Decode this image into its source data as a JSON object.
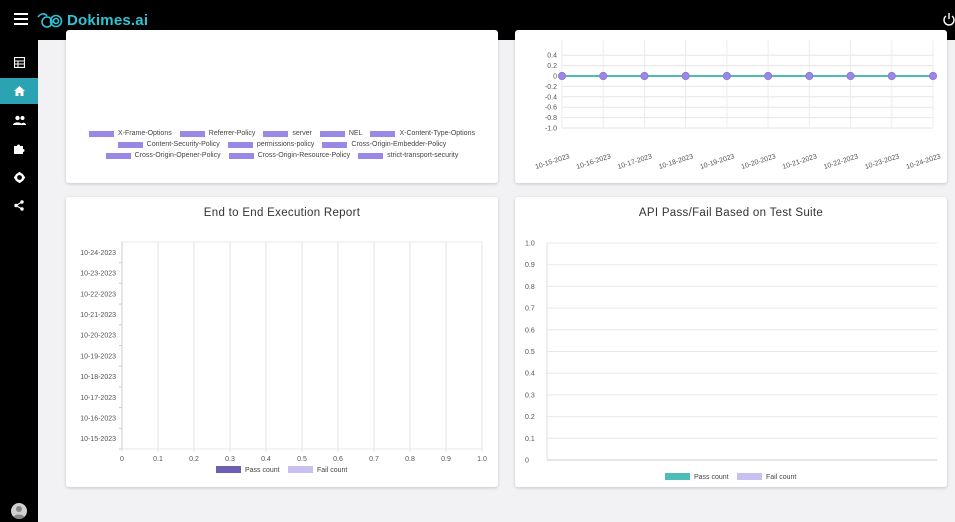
{
  "app": {
    "brand": "Dokimes.ai"
  },
  "sidebar": {
    "items": [
      {
        "icon": "table-icon"
      },
      {
        "icon": "home-icon",
        "active": true
      },
      {
        "icon": "users-icon"
      },
      {
        "icon": "puzzle-icon"
      },
      {
        "icon": "gear-icon"
      },
      {
        "icon": "share-icon"
      }
    ]
  },
  "colors": {
    "accent": "#2ba3b3",
    "brand": "#2ec4d6",
    "legend_purple": "#9b87e6",
    "line_teal": "#4bbcb6",
    "pass_dark": "#6f5fb3",
    "fail_light": "#c9bff0"
  },
  "security_headers_card": {
    "legend": [
      "X-Frame-Options",
      "Referrer-Policy",
      "server",
      "NEL",
      "X-Content-Type-Options",
      "Content-Security-Policy",
      "permissions-policy",
      "Cross-Origin-Embedder-Policy",
      "Cross-Origin-Opener-Policy",
      "Cross-Origin-Resource-Policy",
      "strict-transport-security"
    ]
  },
  "e2e_card": {
    "title": "End to End Execution Report",
    "legend": [
      "Pass count",
      "Fail count"
    ]
  },
  "api_card": {
    "title": "API Pass/Fail Based on Test Suite",
    "legend": [
      "Pass count",
      "Fail count"
    ]
  },
  "chart_data": [
    {
      "type": "line",
      "x": [
        "10-15-2023",
        "10-16-2023",
        "10-17-2023",
        "10-18-2023",
        "10-19-2023",
        "10-20-2023",
        "10-21-2023",
        "10-22-2023",
        "10-23-2023",
        "10-24-2023"
      ],
      "series": [
        {
          "values": [
            0,
            0,
            0,
            0,
            0,
            0,
            0,
            0,
            0,
            0
          ]
        }
      ],
      "yticks_visible": [
        "0.4",
        "0.2",
        "0",
        "-0.2",
        "-0.4",
        "-0.6",
        "-0.8",
        "-1.0"
      ],
      "ylim": [
        -1.0,
        0.4
      ],
      "grid": true
    },
    {
      "type": "bar",
      "orientation": "horizontal",
      "title": "End to End Execution Report",
      "categories": [
        "10-24-2023",
        "10-23-2023",
        "10-22-2023",
        "10-21-2023",
        "10-20-2023",
        "10-19-2023",
        "10-18-2023",
        "10-17-2023",
        "10-16-2023",
        "10-15-2023"
      ],
      "series": [
        {
          "name": "Pass count",
          "values": [
            0,
            0,
            0,
            0,
            0,
            0,
            0,
            0,
            0,
            0
          ]
        },
        {
          "name": "Fail count",
          "values": [
            0,
            0,
            0,
            0,
            0,
            0,
            0,
            0,
            0,
            0
          ]
        }
      ],
      "xticks": [
        "0",
        "0.1",
        "0.2",
        "0.3",
        "0.4",
        "0.5",
        "0.6",
        "0.7",
        "0.8",
        "0.9",
        "1.0"
      ],
      "xlim": [
        0,
        1.0
      ],
      "grid": true,
      "legend_position": "bottom"
    },
    {
      "type": "bar",
      "title": "API Pass/Fail Based on Test Suite",
      "categories": [],
      "series": [
        {
          "name": "Pass count",
          "values": []
        },
        {
          "name": "Fail count",
          "values": []
        }
      ],
      "yticks": [
        "1.0",
        "0.9",
        "0.8",
        "0.7",
        "0.6",
        "0.5",
        "0.4",
        "0.3",
        "0.2",
        "0.1",
        "0"
      ],
      "ylim": [
        0,
        1.0
      ],
      "grid": true,
      "legend_position": "bottom"
    }
  ]
}
